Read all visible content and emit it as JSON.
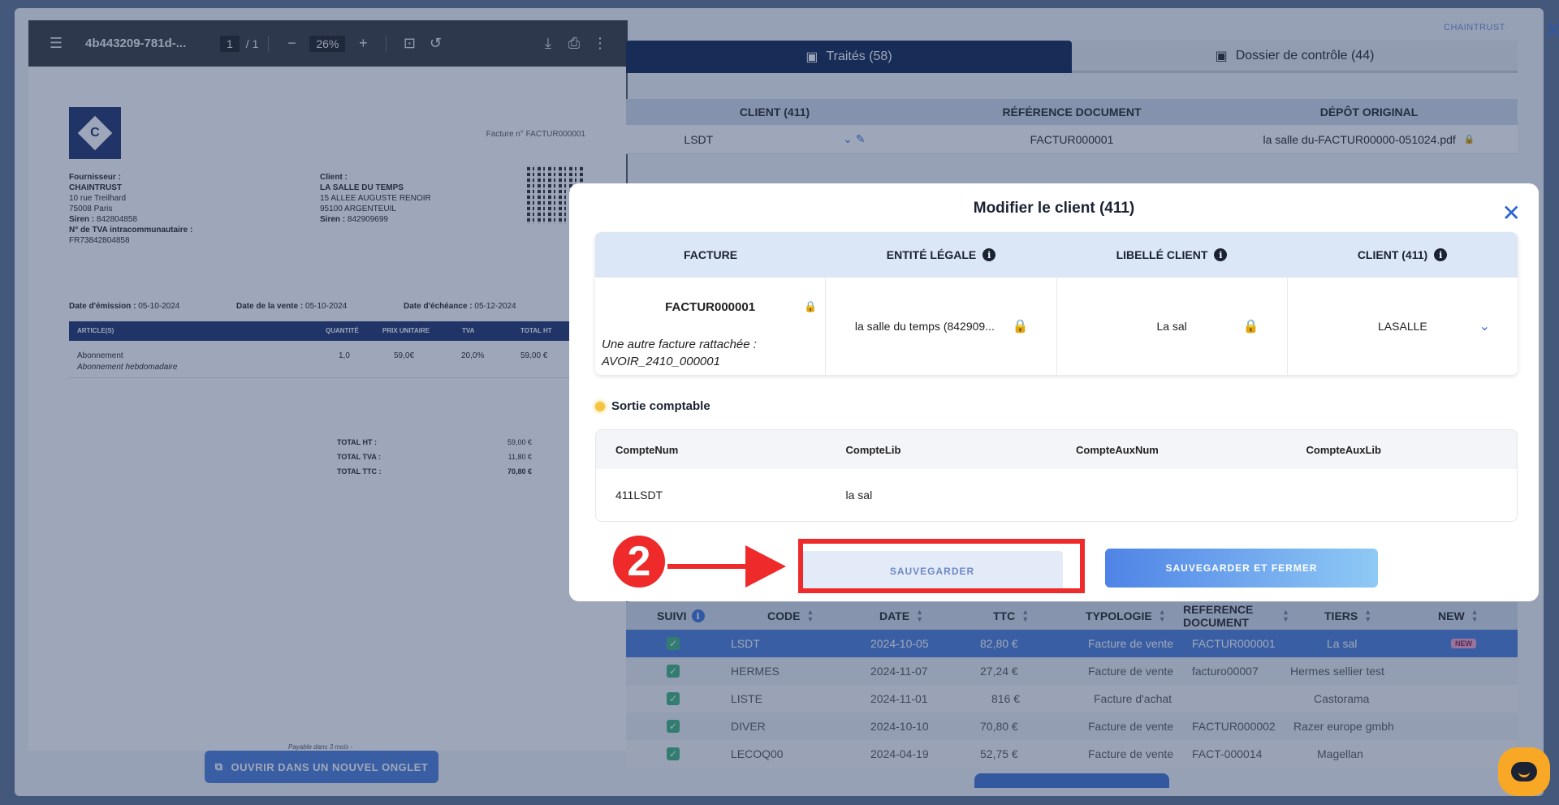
{
  "pdf": {
    "doc_name": "4b443209-781d-...",
    "page_current": "1",
    "page_total": "/ 1",
    "zoom": "26%",
    "open_new_tab_label": "OUVRIR DANS UN NOUVEL ONGLET",
    "invoice": {
      "number": "Facture n° FACTUR000001",
      "supplier_label": "Fournisseur :",
      "supplier_name": "CHAINTRUST",
      "supplier_addr1": "10 rue Treilhard",
      "supplier_addr2": "75008 Paris",
      "supplier_siren_label": "Siren :",
      "supplier_siren": "842804858",
      "supplier_tva_label": "N° de TVA intracommunautaire :",
      "supplier_tva": "FR73842804858",
      "client_label": "Client :",
      "client_name": "LA SALLE DU TEMPS",
      "client_addr1": "15 ALLEE AUGUSTE RENOIR",
      "client_addr2": "95100 ARGENTEUIL",
      "client_siren_label": "Siren :",
      "client_siren": "842909699",
      "emission_label": "Date d'émission :",
      "emission": "05-10-2024",
      "sale_label": "Date de la vente :",
      "sale": "05-10-2024",
      "due_label": "Date d'échéance :",
      "due": "05-12-2024",
      "cols": [
        "ARTICLE(S)",
        "QUANTITÉ",
        "PRIX UNITAIRE",
        "TVA",
        "TOTAL HT"
      ],
      "item_name": "Abonnement",
      "item_desc": "Abonnement hebdomadaire",
      "item_qty": "1,0",
      "item_price": "59,0€",
      "item_tva": "20,0%",
      "item_total": "59,00 €",
      "total_ht_label": "TOTAL HT :",
      "total_ht": "59,00 €",
      "total_tva_label": "TOTAL TVA :",
      "total_tva": "11,80 €",
      "total_ttc_label": "TOTAL TTC :",
      "total_ttc": "70,80 €",
      "footer": "Payable dans 3 mois -"
    }
  },
  "header": {
    "brand": "CHAINTRUST",
    "tab_treated": "Traités (58)",
    "tab_control": "Dossier de contrôle (44)"
  },
  "client_table": {
    "headers": [
      "CLIENT (411)",
      "RÉFÉRENCE DOCUMENT",
      "DÉPÔT ORIGINAL"
    ],
    "client": "LSDT",
    "reference": "FACTUR000001",
    "depot": "la salle du-FACTUR00000-051024.pdf"
  },
  "list_table": {
    "headers": [
      "SUIVI",
      "CODE",
      "DATE",
      "TTC",
      "TYPOLOGIE",
      "REFERENCE DOCUMENT",
      "TIERS",
      "NEW"
    ],
    "rows": [
      {
        "code": "LSDT",
        "date": "2024-10-05",
        "ttc": "82,80 €",
        "type": "Facture de vente",
        "ref": "FACTUR000001",
        "tiers": "La sal",
        "new": "NEW"
      },
      {
        "code": "HERMES",
        "date": "2024-11-07",
        "ttc": "27,24 €",
        "type": "Facture de vente",
        "ref": "facturo00007",
        "tiers": "Hermes sellier test",
        "new": ""
      },
      {
        "code": "LISTE",
        "date": "2024-11-01",
        "ttc": "816 €",
        "type": "Facture d'achat",
        "ref": "",
        "tiers": "Castorama",
        "new": ""
      },
      {
        "code": "DIVER",
        "date": "2024-10-10",
        "ttc": "70,80 €",
        "type": "Facture de vente",
        "ref": "FACTUR000002",
        "tiers": "Razer europe gmbh",
        "new": ""
      },
      {
        "code": "LECOQ00",
        "date": "2024-04-19",
        "ttc": "52,75 €",
        "type": "Facture de vente",
        "ref": "FACT-000014",
        "tiers": "Magellan",
        "new": ""
      }
    ]
  },
  "modal": {
    "title": "Modifier le client (411)",
    "headers": [
      "FACTURE",
      "ENTITÉ LÉGALE",
      "LIBELLÉ CLIENT",
      "CLIENT (411)"
    ],
    "invoice": "FACTUR000001",
    "invoice_note": "Une autre facture rattachée : AVOIR_2410_000001",
    "legal_entity": "la salle du temps (842909...",
    "client_label": "La sal",
    "client_411": "LASALLE",
    "sortie_title": "Sortie comptable",
    "acc_headers": [
      "CompteNum",
      "CompteLib",
      "CompteAuxNum",
      "CompteAuxLib"
    ],
    "acc_row": [
      "411LSDT",
      "la sal",
      "",
      ""
    ],
    "save_label": "SAUVEGARDER",
    "save_close_label": "SAUVEGARDER ET FERMER"
  },
  "annotation": {
    "step": "2",
    "color": "#ee2a2a"
  }
}
